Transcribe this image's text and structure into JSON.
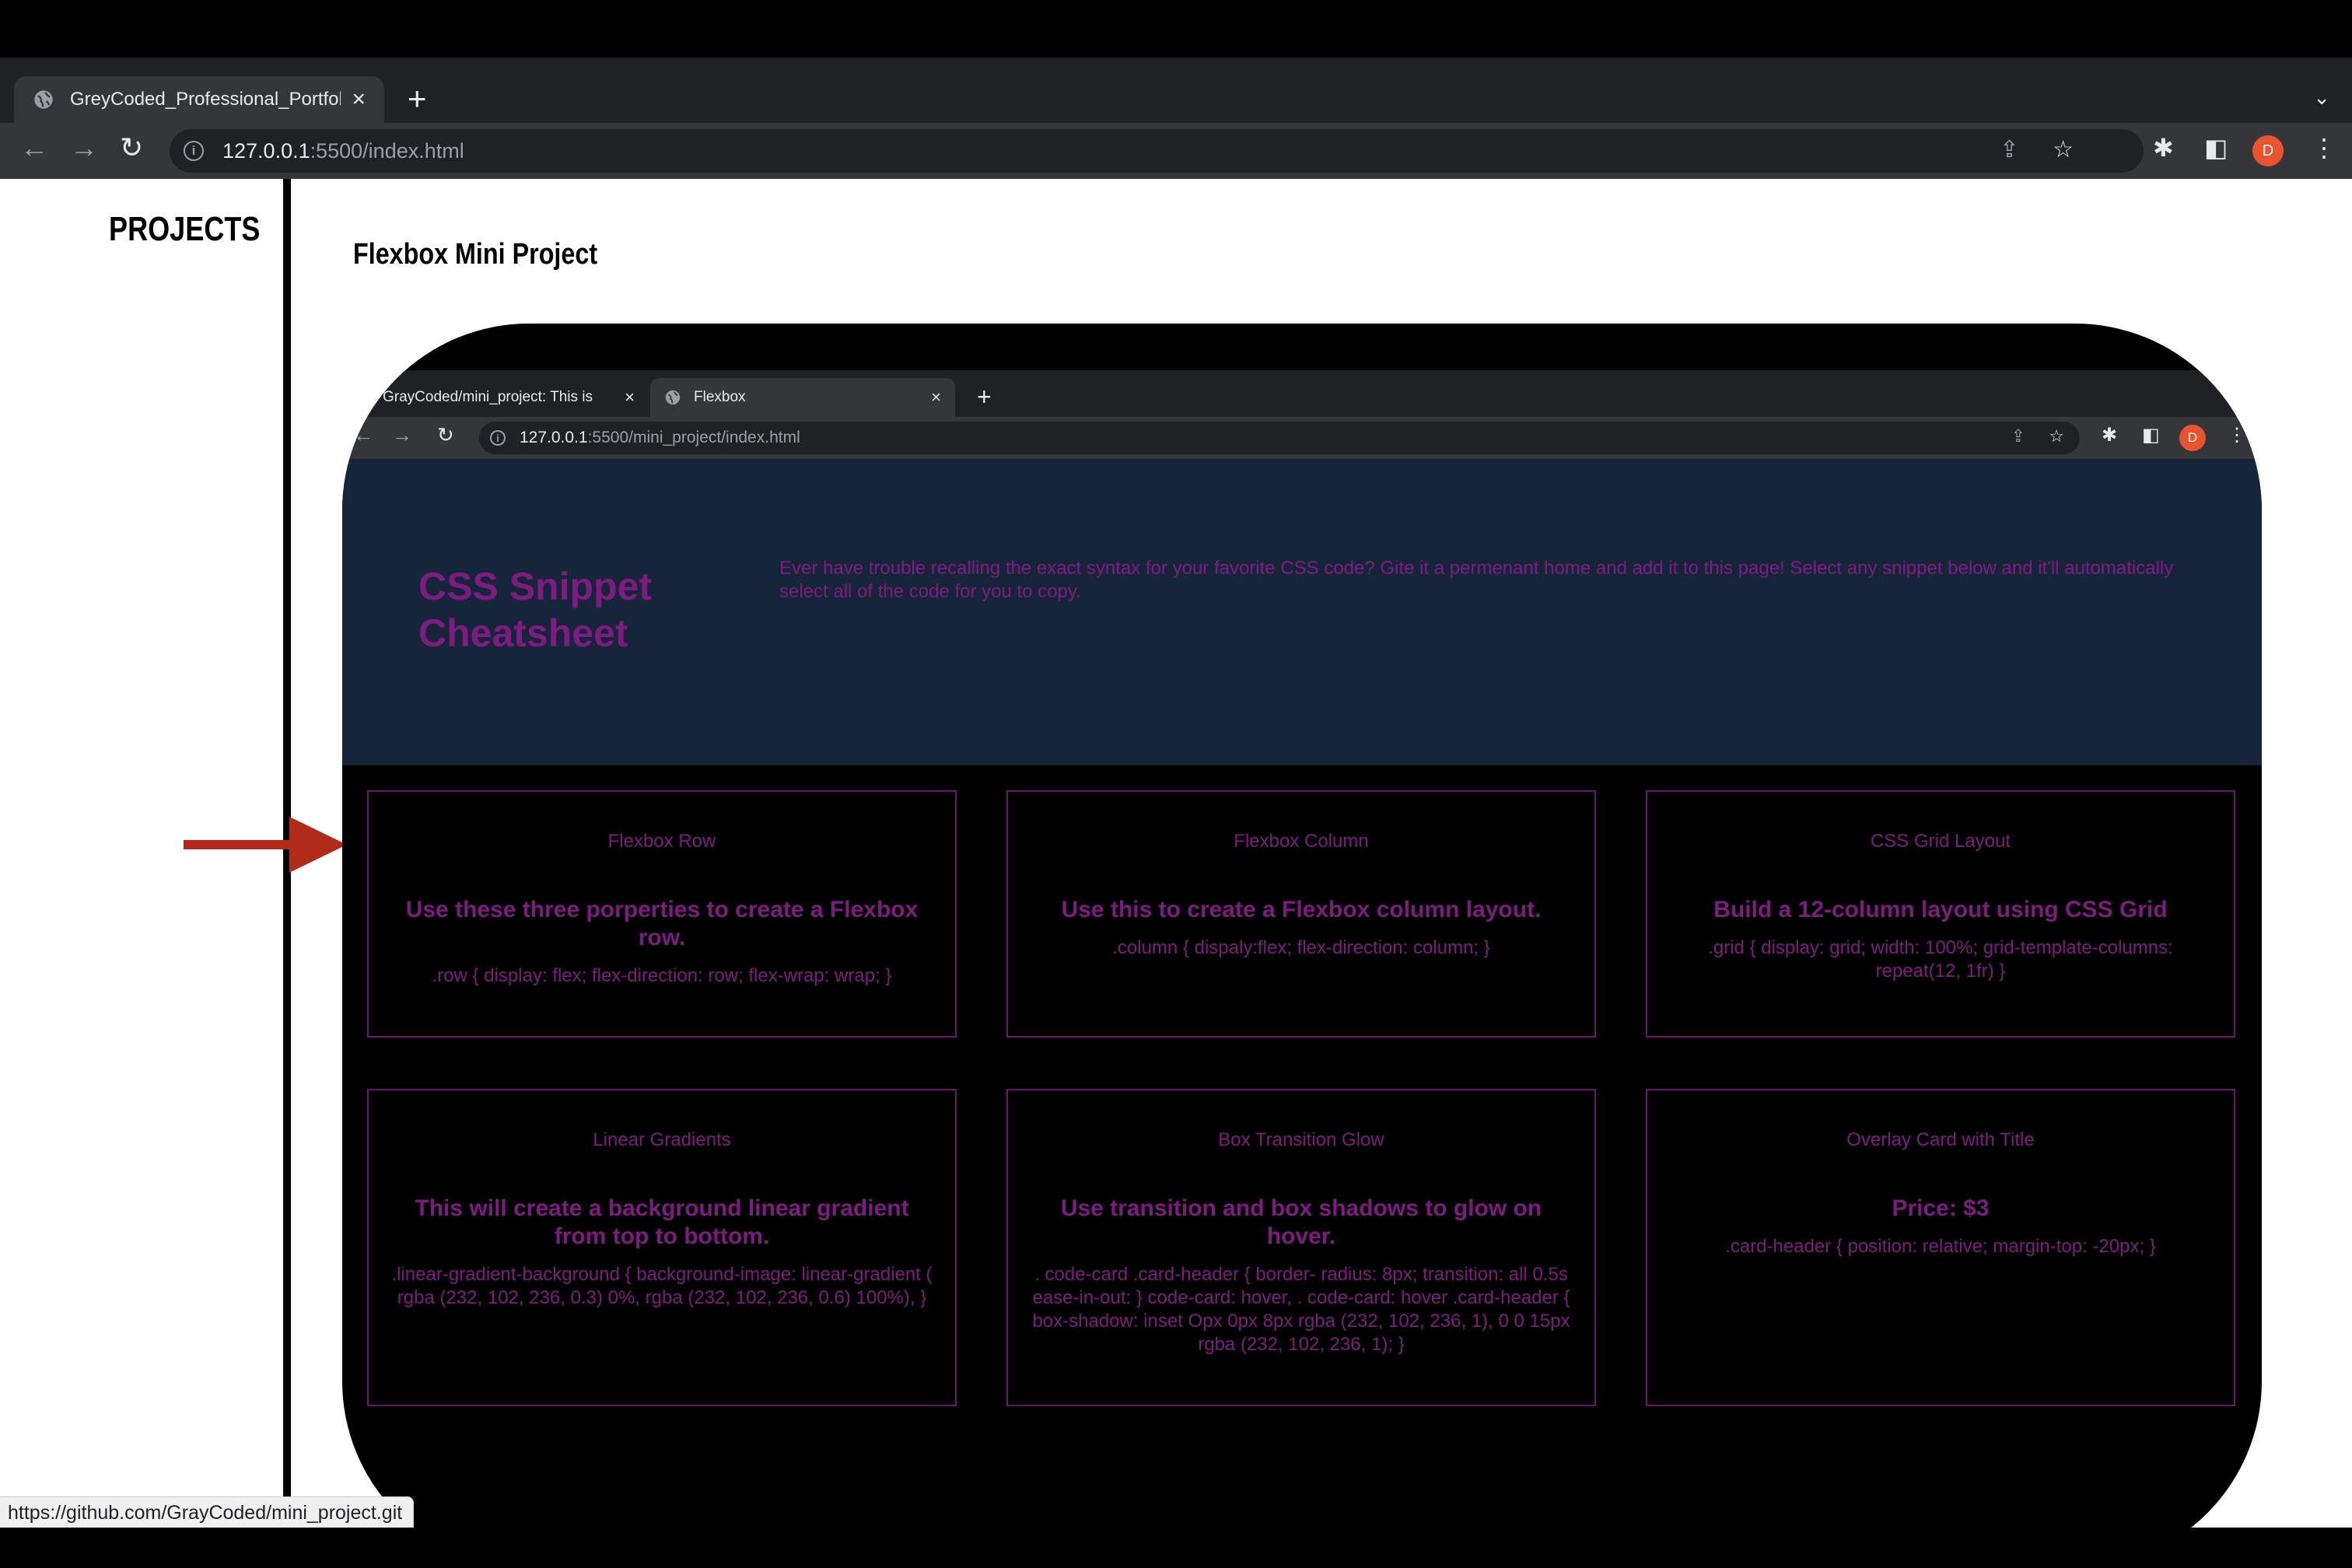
{
  "browser": {
    "tab_title": "GreyCoded_Professional_Portfolio",
    "url_host": "127.0.0.1",
    "url_rest": ":5500/index.html",
    "avatar_letter": "D",
    "icons": [
      "globe-icon",
      "close-icon",
      "plus-icon",
      "chevron-down-icon",
      "back-icon",
      "forward-icon",
      "reload-icon",
      "info-icon",
      "share-icon",
      "star-icon",
      "extensions-icon",
      "sidepanel-icon",
      "menu-icon"
    ]
  },
  "page": {
    "sidebar_heading": "PROJECTS",
    "project_title": "Flexbox Mini Project",
    "arrow_color": "#b22a1a"
  },
  "inner_browser": {
    "tab1_title": "GrayCoded/mini_project: This is",
    "tab2_title": "Flexbox",
    "url_host": "127.0.0.1",
    "url_rest": ":5500/mini_project/index.html",
    "avatar_letter": "D"
  },
  "mini_site": {
    "title": "CSS Snippet Cheatsheet",
    "description": "Ever have trouble recalling the exact syntax for your favorite CSS code? Gite it a permenant home and add it to this page! Select any snippet below and it'll automatically select all of the code for you to copy.",
    "accent_color": "#7e1b80",
    "hero_bg": "#16253a",
    "cards": [
      {
        "title": "Flexbox Row",
        "subtitle": "Use these three porperties to create a Flexbox row.",
        "code": ".row { display: flex; flex-direction: row; flex-wrap: wrap; }"
      },
      {
        "title": "Flexbox Column",
        "subtitle": "Use this to create a Flexbox column layout.",
        "code": ".column { dispaly:flex; flex-direction: column; }"
      },
      {
        "title": "CSS Grid Layout",
        "subtitle": "Build a 12-column layout using CSS Grid",
        "code": ".grid { display: grid; width: 100%; grid-template-columns: repeat(12, 1fr) }"
      },
      {
        "title": "Linear Gradients",
        "subtitle": "This will create a background linear gradient from top to bottom.",
        "code": ".linear-gradient-background { background-image: linear-gradient ( rgba (232, 102, 236, 0.3) 0%, rgba (232, 102, 236, 0.6) 100%), }"
      },
      {
        "title": "Box Transition Glow",
        "subtitle": "Use transition and box shadows to glow on hover.",
        "code": ". code-card .card-header { border- radius: 8px; transition: all 0.5s ease-in-out: } code-card: hover, . code-card: hover .card-header { box-shadow: inset Opx 0px 8px rgba (232, 102, 236, 1), 0 0 15px rgba (232, 102, 236, 1); }"
      },
      {
        "title": "Overlay Card with Title",
        "subtitle": "Price: $3",
        "code": ".card-header { position: relative; margin-top: -20px; }"
      }
    ]
  },
  "status_url": "https://github.com/GrayCoded/mini_project.git"
}
